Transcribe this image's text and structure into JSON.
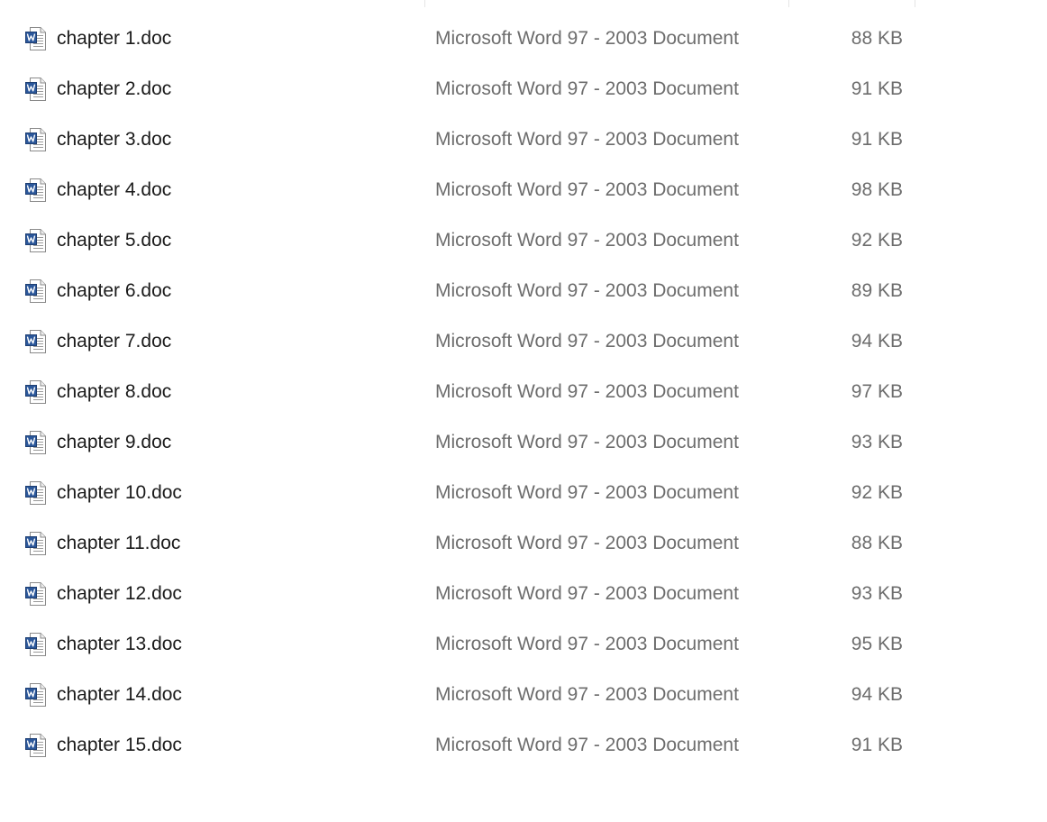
{
  "file_list": {
    "icon": "word-doc-icon",
    "colors": {
      "name_text": "#1a1a1a",
      "meta_text": "#6d6d6d",
      "icon_blue": "#2b579a"
    },
    "files": [
      {
        "name": "chapter 1.doc",
        "type": "Microsoft Word 97 - 2003 Document",
        "size": "88 KB"
      },
      {
        "name": "chapter 2.doc",
        "type": "Microsoft Word 97 - 2003 Document",
        "size": "91 KB"
      },
      {
        "name": "chapter 3.doc",
        "type": "Microsoft Word 97 - 2003 Document",
        "size": "91 KB"
      },
      {
        "name": "chapter 4.doc",
        "type": "Microsoft Word 97 - 2003 Document",
        "size": "98 KB"
      },
      {
        "name": "chapter 5.doc",
        "type": "Microsoft Word 97 - 2003 Document",
        "size": "92 KB"
      },
      {
        "name": "chapter 6.doc",
        "type": "Microsoft Word 97 - 2003 Document",
        "size": "89 KB"
      },
      {
        "name": "chapter 7.doc",
        "type": "Microsoft Word 97 - 2003 Document",
        "size": "94 KB"
      },
      {
        "name": "chapter 8.doc",
        "type": "Microsoft Word 97 - 2003 Document",
        "size": "97 KB"
      },
      {
        "name": "chapter 9.doc",
        "type": "Microsoft Word 97 - 2003 Document",
        "size": "93 KB"
      },
      {
        "name": "chapter 10.doc",
        "type": "Microsoft Word 97 - 2003 Document",
        "size": "92 KB"
      },
      {
        "name": "chapter 11.doc",
        "type": "Microsoft Word 97 - 2003 Document",
        "size": "88 KB"
      },
      {
        "name": "chapter 12.doc",
        "type": "Microsoft Word 97 - 2003 Document",
        "size": "93 KB"
      },
      {
        "name": "chapter 13.doc",
        "type": "Microsoft Word 97 - 2003 Document",
        "size": "95 KB"
      },
      {
        "name": "chapter 14.doc",
        "type": "Microsoft Word 97 - 2003 Document",
        "size": "94 KB"
      },
      {
        "name": "chapter 15.doc",
        "type": "Microsoft Word 97 - 2003 Document",
        "size": "91 KB"
      }
    ]
  }
}
